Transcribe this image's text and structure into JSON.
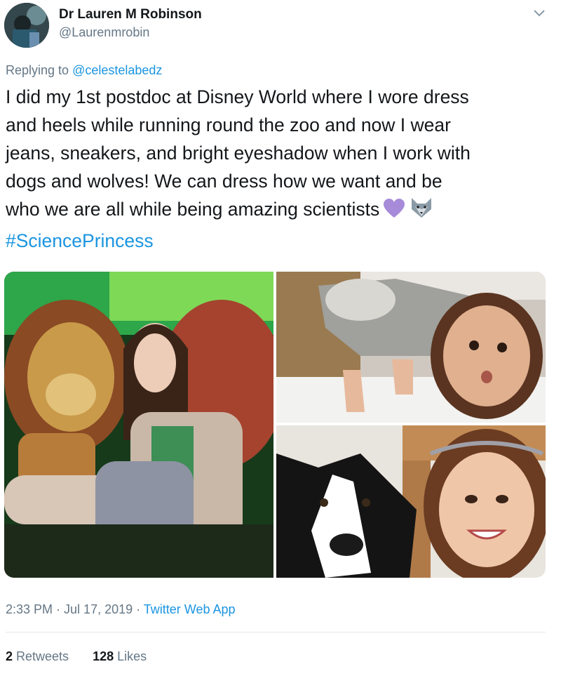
{
  "author": {
    "display_name": "Dr Lauren M Robinson",
    "handle": "@Laurenmrobin",
    "avatar_icon": "avatar-photo"
  },
  "reply": {
    "prefix": "Replying to ",
    "mention": "@celestelabedz"
  },
  "tweet": {
    "line1": "I did my 1st postdoc at Disney World where I wore dress",
    "line2": "and heels while running round the zoo and now I wear",
    "line3": "jeans, sneakers, and bright eyeshadow when I work with",
    "line4": "dogs and wolves! We can dress how we want and be",
    "line5": "who we are all while being amazing scientists",
    "emoji_1": "purple-heart-icon",
    "emoji_2": "wolf-face-icon",
    "hashtag": "#SciencePrincess"
  },
  "media": {
    "photos": [
      "lion-statue-selfie",
      "wolf-exhibit-selfie",
      "dog-selfie"
    ]
  },
  "meta": {
    "time": "2:33 PM",
    "sep1": " · ",
    "date": "Jul 17, 2019",
    "sep2": " · ",
    "source": "Twitter Web App"
  },
  "stats": {
    "retweets_count": "2",
    "retweets_label": " Retweets",
    "likes_count": "128",
    "likes_label": " Likes"
  },
  "colors": {
    "link": "#1b95e0",
    "secondary_text": "#657786",
    "primary_text": "#14171a",
    "divider": "#e1e8ed"
  }
}
